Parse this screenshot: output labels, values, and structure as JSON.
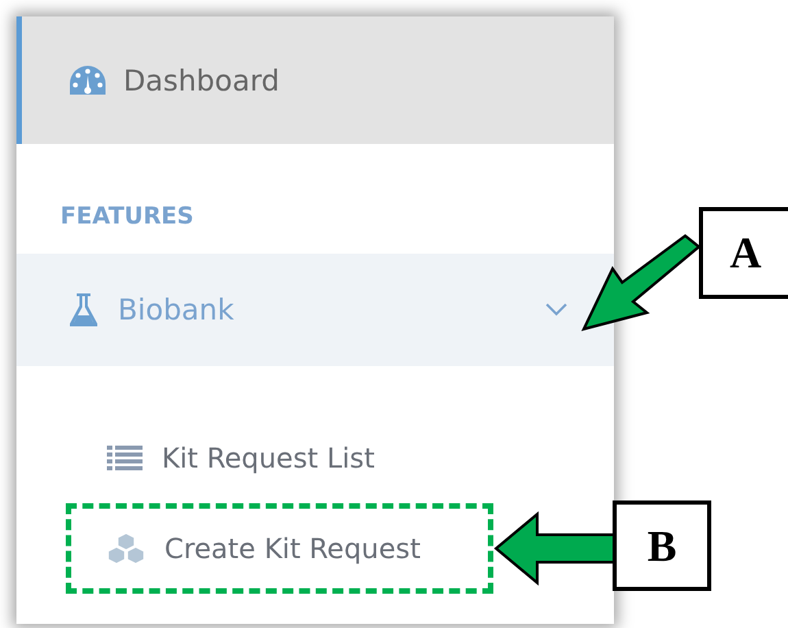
{
  "sidebar": {
    "dashboard": {
      "label": "Dashboard",
      "selected": true
    },
    "section_heading": "FEATURES",
    "groups": [
      {
        "label": "Biobank",
        "expanded": true,
        "children": [
          {
            "label": "Kit Request List",
            "highlighted": false
          },
          {
            "label": "Create Kit Request",
            "highlighted": true
          }
        ]
      }
    ]
  },
  "callouts": [
    {
      "label": "A"
    },
    {
      "label": "B"
    }
  ]
}
